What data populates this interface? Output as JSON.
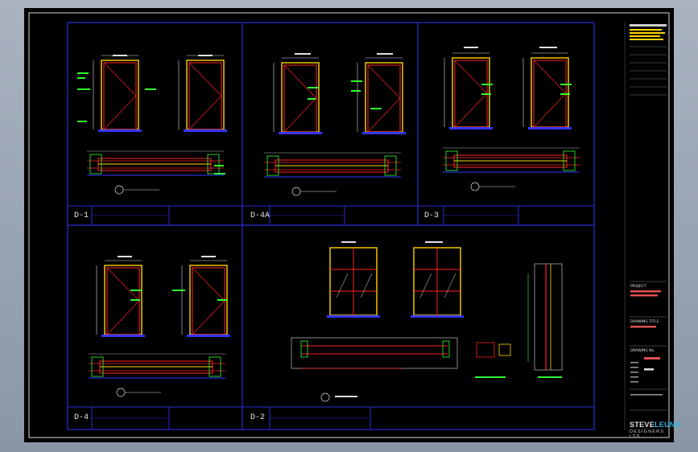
{
  "panels": [
    {
      "code": "D-1"
    },
    {
      "code": "D-4A"
    },
    {
      "code": "D-3"
    },
    {
      "code": "D-4"
    },
    {
      "code": "D-2"
    }
  ],
  "title_block": {
    "project_label": "PROJECT",
    "drawing_title_label": "DRAWING TITLE",
    "drawing_no_label": "DRAWING No."
  },
  "logo": {
    "main": "STEVE",
    "accent": "LEUNG",
    "sub": "DESIGNERS LTD"
  },
  "colors": {
    "background": "#000000",
    "frame": "#2a2ad8",
    "door": "#ff2020",
    "frame_trim": "#ffd400",
    "annotation": "#30ff30",
    "dimension": "#e0e0e0"
  }
}
